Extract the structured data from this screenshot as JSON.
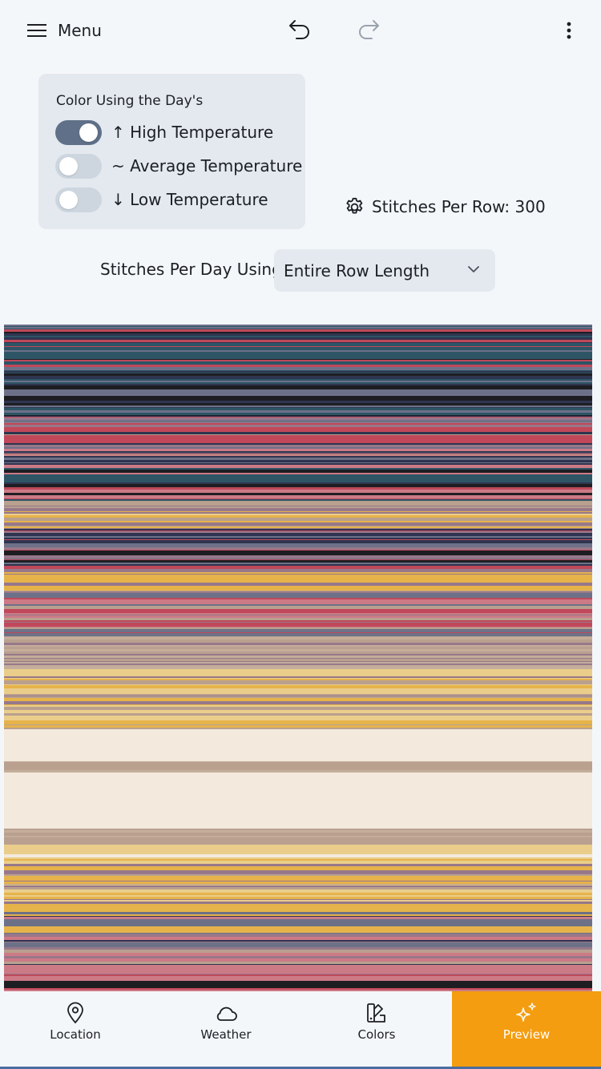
{
  "header": {
    "menu_label": "Menu",
    "icons": {
      "menu": "hamburger-icon",
      "undo": "undo-icon",
      "redo": "redo-icon",
      "more": "more-vertical-icon"
    }
  },
  "color_panel": {
    "title": "Color Using the Day's",
    "toggles": [
      {
        "label": "↑ High Temperature",
        "on": true
      },
      {
        "label": "~ Average Temperature",
        "on": false
      },
      {
        "label": "↓ Low Temperature",
        "on": false
      }
    ]
  },
  "stitches_per_row": {
    "label": "Stitches Per Row: 300",
    "icon": "gear-icon"
  },
  "stitches_per_day": {
    "label": "Stitches Per Day Using",
    "selected": "Entire Row Length"
  },
  "stripe_colors": {
    "navy": "#2f3550",
    "teal": "#2d5566",
    "black": "#1e1e22",
    "red": "#c0485a",
    "pink": "#cc7a86",
    "mauve": "#97788a",
    "tan": "#b9a08f",
    "gold": "#e6b34b",
    "lightgold": "#eacd8a",
    "cream": "#f3e9dc",
    "beige": "#c4ad9a",
    "slate": "#6d7188"
  },
  "nav": {
    "items": [
      {
        "label": "Location",
        "icon": "location-pin-icon",
        "active": false
      },
      {
        "label": "Weather",
        "icon": "cloud-icon",
        "active": false
      },
      {
        "label": "Colors",
        "icon": "swatches-icon",
        "active": false
      },
      {
        "label": "Preview",
        "icon": "sparkles-icon",
        "active": true
      }
    ],
    "active_color": "#f49d10"
  }
}
